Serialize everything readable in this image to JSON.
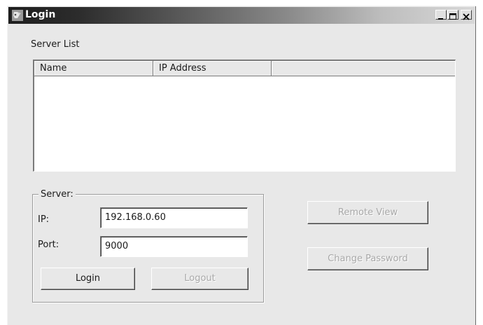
{
  "window": {
    "title": "Login"
  },
  "server_list": {
    "label": "Server List",
    "columns": [
      "Name",
      "IP Address",
      ""
    ],
    "rows": []
  },
  "server_group": {
    "title": "Server:",
    "ip_label": "IP:",
    "ip_value": "192.168.0.60",
    "port_label": "Port:",
    "port_value": "9000",
    "login_label": "Login",
    "logout_label": "Logout"
  },
  "actions": {
    "remote_view_label": "Remote View",
    "change_password_label": "Change Password"
  },
  "icons": {
    "app": "app-icon",
    "minimize": "minimize-icon",
    "maximize": "maximize-icon",
    "close": "close-icon"
  }
}
